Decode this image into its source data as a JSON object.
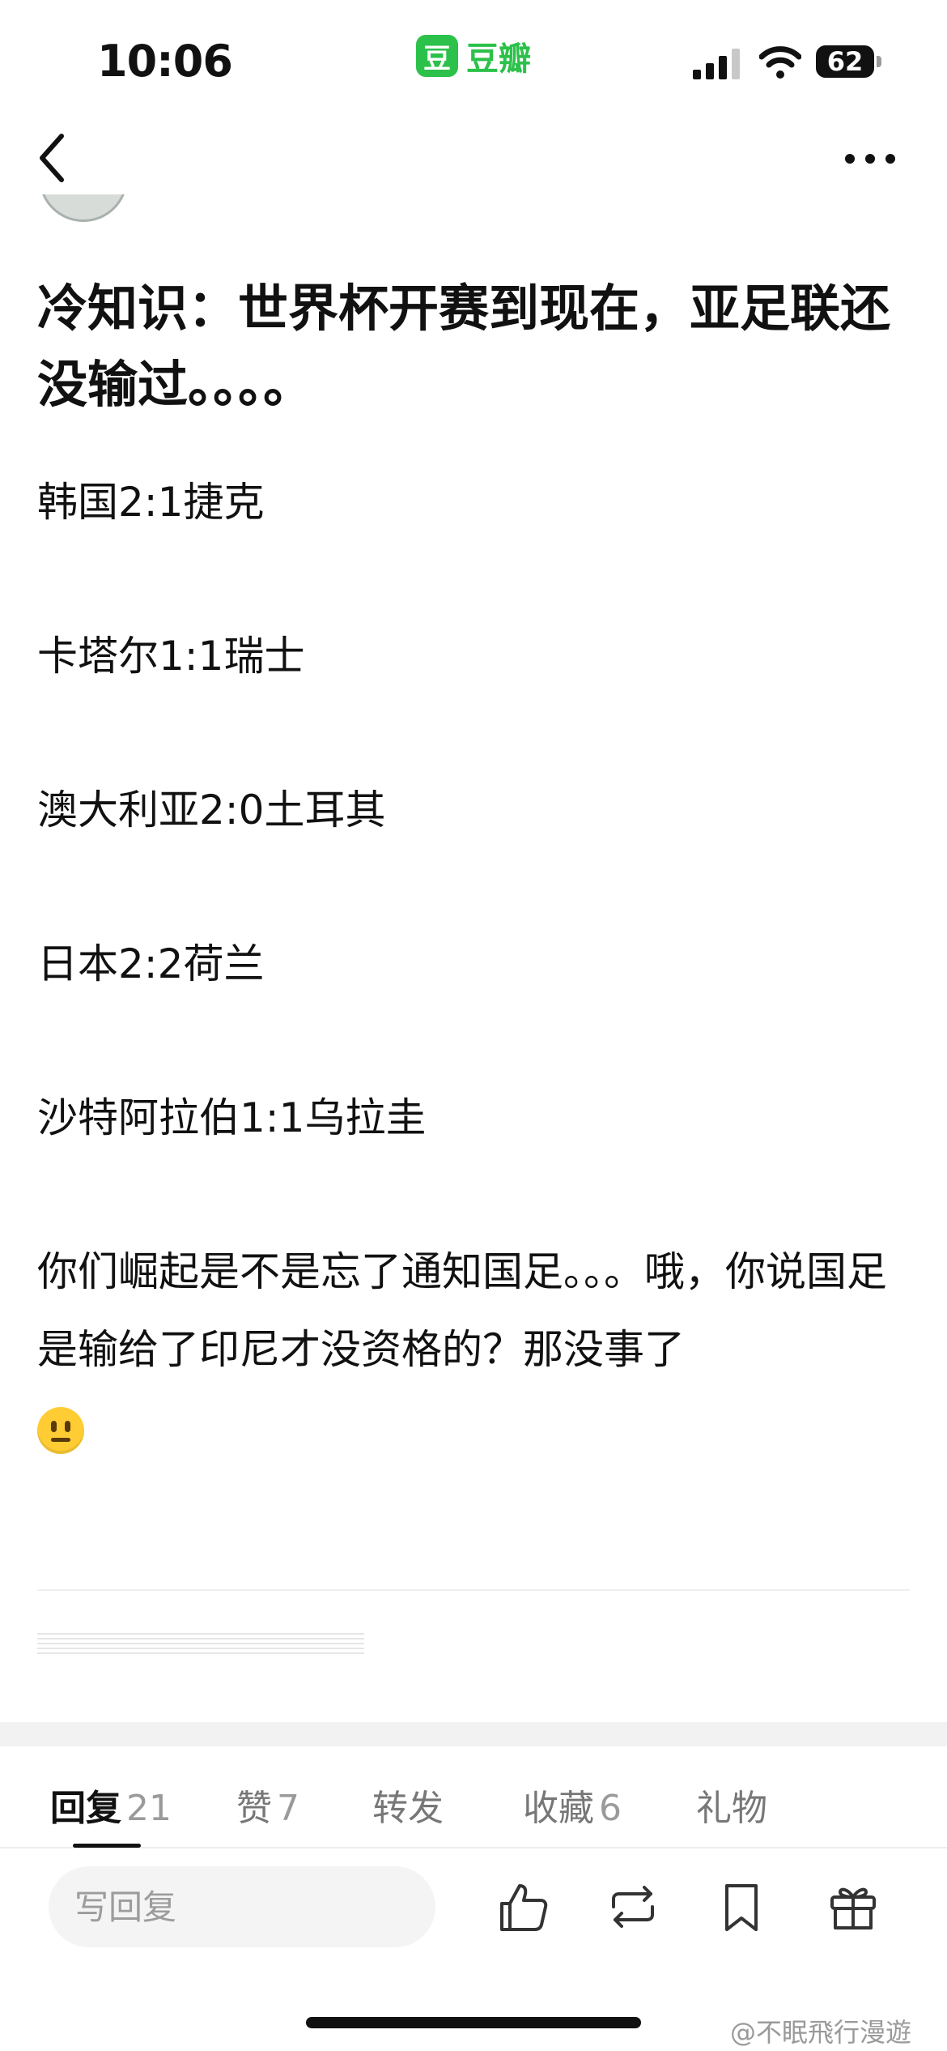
{
  "status_bar": {
    "time": "10:06",
    "app_logo_char": "豆",
    "app_name": "豆瓣",
    "battery": "62"
  },
  "post": {
    "title": "冷知识：世界杯开赛到现在，亚足联还没输过。。。。",
    "results": [
      "韩国2:1捷克",
      "卡塔尔1:1瑞士",
      "澳大利亚2:0土耳其",
      "日本2:2荷兰",
      "沙特阿拉伯1:1乌拉圭"
    ],
    "closing_text": "你们崛起是不是忘了通知国足。。。哦，你说国足是输给了印尼才没资格的？那没事了",
    "emoji": "neutral-face-emoji"
  },
  "tabs": [
    {
      "label": "回复",
      "count": "21",
      "active": true
    },
    {
      "label": "赞",
      "count": "7",
      "active": false
    },
    {
      "label": "转发",
      "count": "",
      "active": false
    },
    {
      "label": "收藏",
      "count": "6",
      "active": false
    },
    {
      "label": "礼物",
      "count": "",
      "active": false
    }
  ],
  "reply_bar": {
    "placeholder": "写回复",
    "icons": [
      "like-icon",
      "repost-icon",
      "bookmark-icon",
      "gift-icon"
    ]
  },
  "watermark": "@不眠飛行漫遊",
  "colors": {
    "brand": "#2cc14a",
    "text": "#111111",
    "muted": "#777777"
  }
}
